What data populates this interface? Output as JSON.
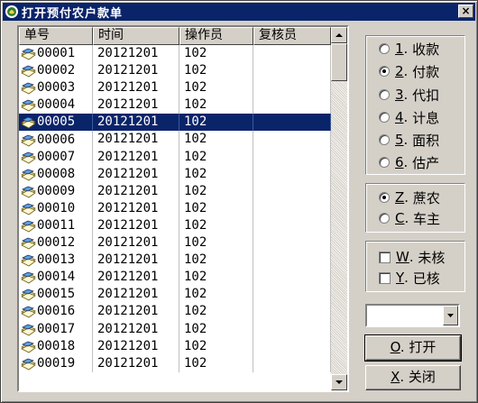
{
  "window": {
    "title": "打开预付农户款单",
    "close_glyph": "×"
  },
  "list": {
    "columns": [
      "单号",
      "时间",
      "操作员",
      "复核员"
    ],
    "selected_index": 4,
    "rows": [
      [
        "00001",
        "20121201",
        "102",
        ""
      ],
      [
        "00002",
        "20121201",
        "102",
        ""
      ],
      [
        "00003",
        "20121201",
        "102",
        ""
      ],
      [
        "00004",
        "20121201",
        "102",
        ""
      ],
      [
        "00005",
        "20121201",
        "102",
        ""
      ],
      [
        "00006",
        "20121201",
        "102",
        ""
      ],
      [
        "00007",
        "20121201",
        "102",
        ""
      ],
      [
        "00008",
        "20121201",
        "102",
        ""
      ],
      [
        "00009",
        "20121201",
        "102",
        ""
      ],
      [
        "00010",
        "20121201",
        "102",
        ""
      ],
      [
        "00011",
        "20121201",
        "102",
        ""
      ],
      [
        "00012",
        "20121201",
        "102",
        ""
      ],
      [
        "00013",
        "20121201",
        "102",
        ""
      ],
      [
        "00014",
        "20121201",
        "102",
        ""
      ],
      [
        "00015",
        "20121201",
        "102",
        ""
      ],
      [
        "00016",
        "20121201",
        "102",
        ""
      ],
      [
        "00017",
        "20121201",
        "102",
        ""
      ],
      [
        "00018",
        "20121201",
        "102",
        ""
      ],
      [
        "00019",
        "20121201",
        "102",
        ""
      ]
    ],
    "row_icon": "document-stack-icon"
  },
  "type_options": [
    {
      "key": "1",
      "label": "收款",
      "checked": false
    },
    {
      "key": "2",
      "label": "付款",
      "checked": true
    },
    {
      "key": "3",
      "label": "代扣",
      "checked": false
    },
    {
      "key": "4",
      "label": "计息",
      "checked": false
    },
    {
      "key": "5",
      "label": "面积",
      "checked": false
    },
    {
      "key": "6",
      "label": "估产",
      "checked": false
    }
  ],
  "payee_options": [
    {
      "key": "Z",
      "label": "蔗农",
      "checked": true
    },
    {
      "key": "C",
      "label": "车主",
      "checked": false
    }
  ],
  "review_options": [
    {
      "key": "W",
      "label": "未核",
      "checked": false
    },
    {
      "key": "Y",
      "label": "已核",
      "checked": false
    }
  ],
  "combo": {
    "value": ""
  },
  "buttons": {
    "open": {
      "key": "O",
      "label": "打开"
    },
    "close": {
      "key": "X",
      "label": "关闭"
    }
  },
  "colors": {
    "titlebar": "#0a246a",
    "face": "#d4d0c8",
    "selection": "#0a246a"
  }
}
